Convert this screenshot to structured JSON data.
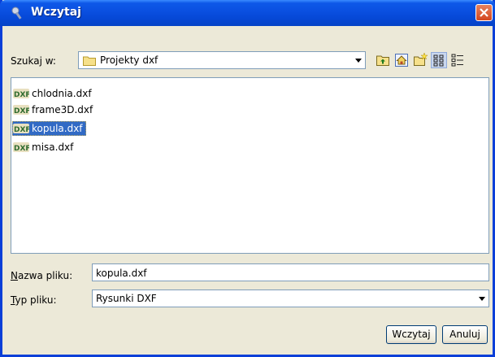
{
  "window": {
    "title": "Wczytaj"
  },
  "look_in": {
    "label": "Szukaj w:",
    "value": "Projekty dxf"
  },
  "toolbar": {
    "icons": [
      "up-folder-icon",
      "home-icon",
      "new-folder-icon",
      "list-view-icon",
      "details-view-icon"
    ]
  },
  "files": [
    {
      "name": "chlodnia.dxf",
      "selected": false
    },
    {
      "name": "frame3D.dxf",
      "selected": false
    },
    {
      "name": "kopula.dxf",
      "selected": true
    },
    {
      "name": "misa.dxf",
      "selected": false
    }
  ],
  "file_name": {
    "label_mnemonic": "N",
    "label_rest": "azwa pliku:",
    "value": "kopula.dxf"
  },
  "file_type": {
    "label_mnemonic": "T",
    "label_rest": "yp pliku:",
    "value": "Rysunki DXF"
  },
  "buttons": {
    "open": "Wczytaj",
    "cancel": "Anuluj"
  },
  "colors": {
    "titlebar": "#0a4fe0",
    "selection": "#316ac5",
    "window_bg": "#ece9d8"
  }
}
